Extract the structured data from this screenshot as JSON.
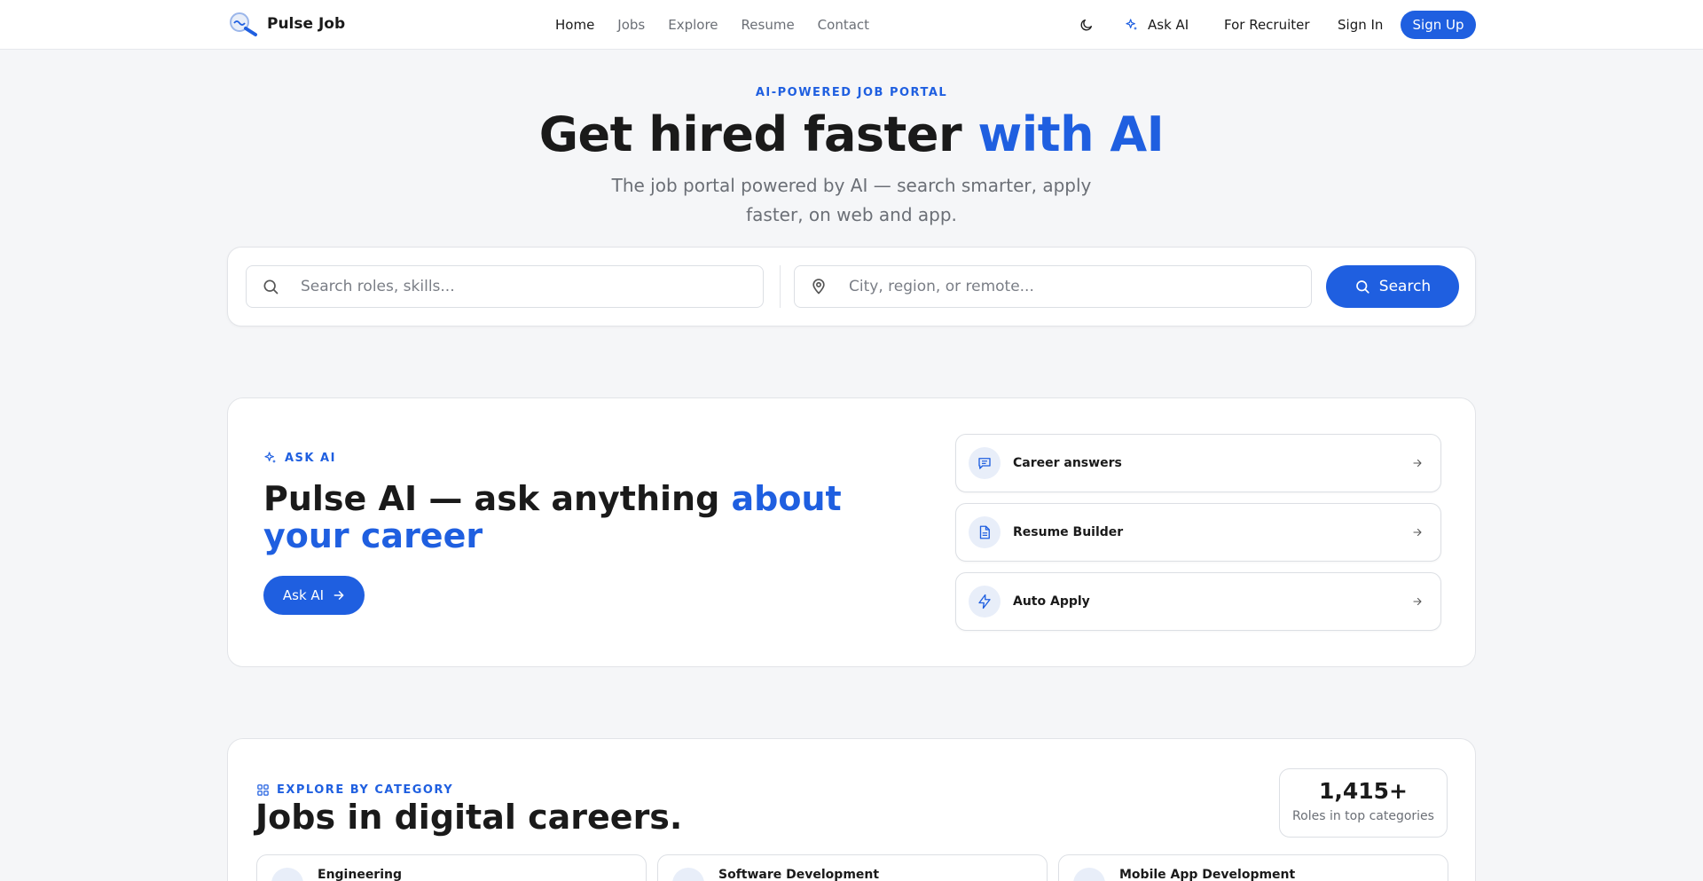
{
  "header": {
    "brand": "Pulse Job",
    "nav": [
      "Home",
      "Jobs",
      "Explore",
      "Resume",
      "Contact"
    ],
    "ask_ai": "Ask AI",
    "for_recruiter": "For Recruiter",
    "sign_in": "Sign In",
    "sign_up": "Sign Up"
  },
  "hero": {
    "eyebrow": "AI-POWERED JOB PORTAL",
    "title_main": "Get hired faster ",
    "title_accent": "with AI",
    "subtitle": "The job portal powered by AI — search smarter, apply faster, on web and app."
  },
  "search": {
    "keyword_placeholder": "Search roles, skills...",
    "location_placeholder": "City, region, or remote...",
    "button": "Search"
  },
  "ask_ai_section": {
    "eyebrow": "ASK AI",
    "title_main": "Pulse AI — ask anything ",
    "title_accent": "about your career",
    "button": "Ask AI",
    "features": [
      {
        "label": "Career answers",
        "icon": "chat-icon"
      },
      {
        "label": "Resume Builder",
        "icon": "document-icon"
      },
      {
        "label": "Auto Apply",
        "icon": "lightning-icon"
      }
    ]
  },
  "category_section": {
    "eyebrow": "EXPLORE BY CATEGORY",
    "title": "Jobs in digital careers.",
    "stat_value": "1,415+",
    "stat_label": "Roles in top categories",
    "categories": [
      "Engineering",
      "Software Development",
      "Mobile App Development"
    ]
  },
  "colors": {
    "accent": "#1f5fe0",
    "background": "#f5f6f8",
    "text": "#1a1a1a",
    "muted": "#6b6f76"
  }
}
